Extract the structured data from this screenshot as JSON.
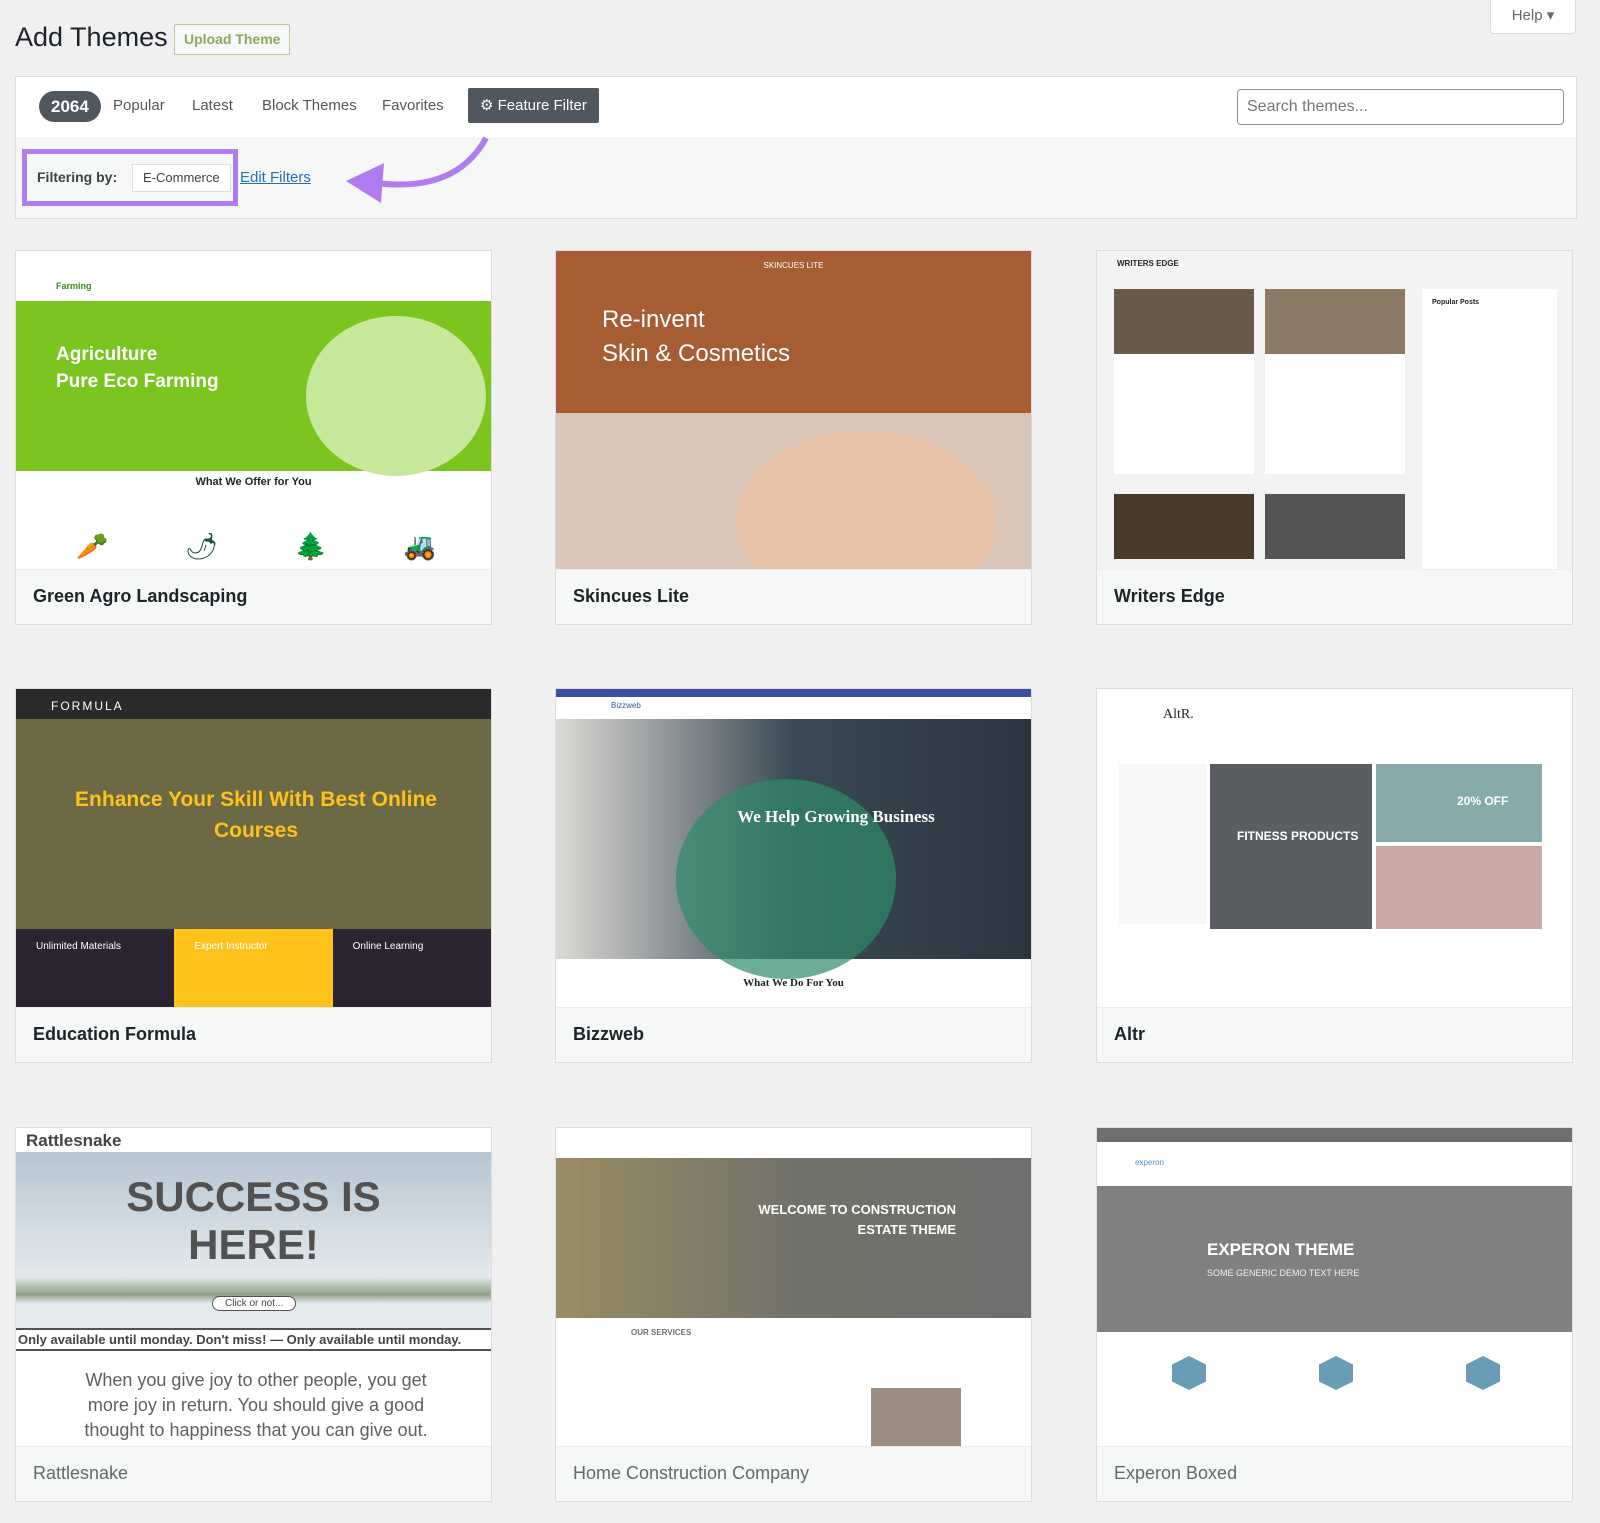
{
  "header": {
    "title": "Add Themes",
    "upload_label": "Upload Theme",
    "help_label": "Help ▾"
  },
  "filter_bar": {
    "count": "2064",
    "tabs": [
      "Popular",
      "Latest",
      "Block Themes",
      "Favorites"
    ],
    "feature_filter_label": "Feature Filter",
    "feature_filter_icon": "gear-icon",
    "search_placeholder": "Search themes...",
    "filtering_label": "Filtering by:",
    "filter_tag": "E-Commerce",
    "edit_filters": "Edit Filters",
    "highlight_color": "#b07df0"
  },
  "themes": [
    {
      "name": "Green Agro Landscaping",
      "headline": "Agriculture\nPure Eco Farming",
      "sub": "What We Offer for You",
      "brand": "Farming"
    },
    {
      "name": "Skincues Lite",
      "headline": "Re-invent\nSkin & Cosmetics",
      "brand": "SKINCUES LITE"
    },
    {
      "name": "Writers Edge",
      "brand": "WRITERS EDGE",
      "sub": "Popular Posts"
    },
    {
      "name": "Education Formula",
      "headline": "Enhance Your Skill With Best Online Courses",
      "brand": "FORMULA",
      "cols": [
        "Unlimited Materials",
        "Expert Instructor",
        "Online Learning"
      ]
    },
    {
      "name": "Bizzweb",
      "headline": "We Help Growing Business",
      "sub": "What We Do For You",
      "brand": "Bizzweb"
    },
    {
      "name": "Altr",
      "brand": "AltR.",
      "sub": "FITNESS PRODUCTS",
      "promo": "20% OFF"
    },
    {
      "name": "Rattlesnake",
      "brand": "Rattlesnake",
      "headline": "SUCCESS IS HERE!",
      "button": "Click or not...",
      "banner": "Only available until monday. Don't miss! — Only available until monday.",
      "body": "When you give joy to other people, you get more joy in return. You should give a good thought to happiness that you can give out."
    },
    {
      "name": "Home Construction Company",
      "headline": "WELCOME TO CONSTRUCTION ESTATE THEME",
      "sub": "OUR SERVICES"
    },
    {
      "name": "Experon Boxed",
      "brand": "experon",
      "headline": "EXPERON THEME",
      "sub": "SOME GENERIC DEMO TEXT HERE"
    }
  ]
}
